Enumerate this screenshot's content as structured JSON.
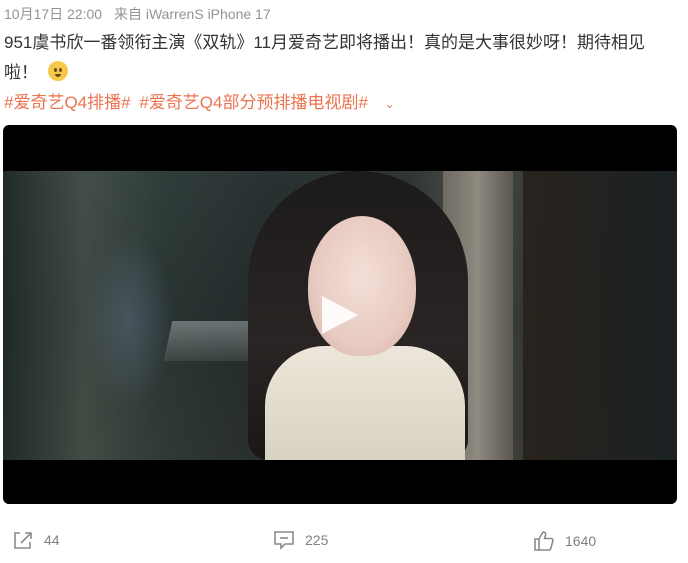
{
  "meta": {
    "date": "10月17日 22:00",
    "source": "来自 iWarrenS iPhone 17"
  },
  "post": {
    "text": "951虞书欣一番领衔主演《双轨》11月爱奇艺即将播出！真的是大事很妙呀！期待相见啦！",
    "emoji_icon": "pleading-face-emoji"
  },
  "tags": [
    "#爱奇艺Q4排播#",
    "#爱奇艺Q4部分预排播电视剧#"
  ],
  "video": {
    "play_icon": "play-triangle-icon"
  },
  "actions": {
    "share": {
      "icon": "share-icon",
      "count": "44"
    },
    "comment": {
      "icon": "comment-icon",
      "count": "225"
    },
    "like": {
      "icon": "thumbs-up-icon",
      "count": "1640"
    }
  }
}
